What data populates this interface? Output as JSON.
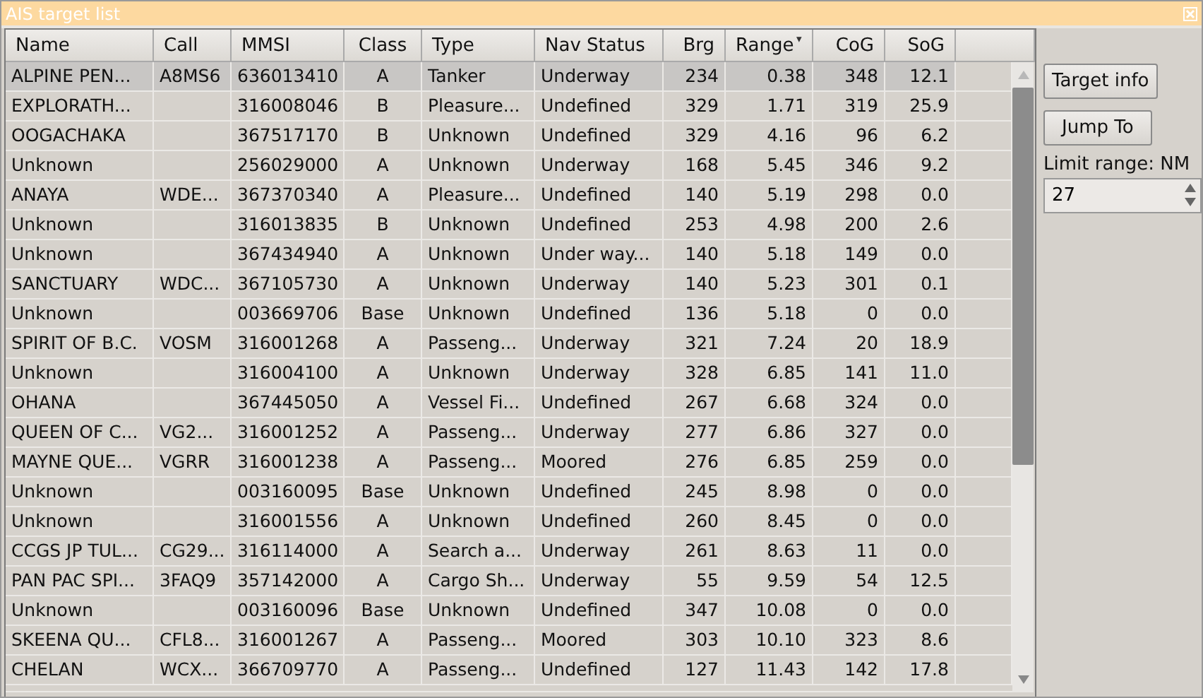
{
  "window": {
    "title": "AIS target list"
  },
  "table": {
    "columns": [
      {
        "label": "Name",
        "sorted": false
      },
      {
        "label": "Call",
        "sorted": false
      },
      {
        "label": "MMSI",
        "sorted": false
      },
      {
        "label": "Class",
        "sorted": false
      },
      {
        "label": "Type",
        "sorted": false
      },
      {
        "label": "Nav Status",
        "sorted": false
      },
      {
        "label": "Brg",
        "sorted": false
      },
      {
        "label": "Range",
        "sorted": true
      },
      {
        "label": "CoG",
        "sorted": false
      },
      {
        "label": "SoG",
        "sorted": false
      }
    ],
    "rows": [
      {
        "selected": true,
        "cells": [
          "ALPINE PEN...",
          "A8MS6",
          "636013410",
          "A",
          "Tanker",
          "Underway",
          "234",
          "0.38",
          "348",
          "12.1"
        ]
      },
      {
        "selected": false,
        "cells": [
          "EXPLORATH...",
          "",
          "316008046",
          "B",
          "Pleasure...",
          "Undefined",
          "329",
          "1.71",
          "319",
          "25.9"
        ]
      },
      {
        "selected": false,
        "cells": [
          "OOGACHAKA",
          "",
          "367517170",
          "B",
          "Unknown",
          "Undefined",
          "329",
          "4.16",
          "96",
          "6.2"
        ]
      },
      {
        "selected": false,
        "cells": [
          "Unknown",
          "",
          "256029000",
          "A",
          "Unknown",
          "Underway",
          "168",
          "5.45",
          "346",
          "9.2"
        ]
      },
      {
        "selected": false,
        "cells": [
          "ANAYA",
          "WDE...",
          "367370340",
          "A",
          "Pleasure...",
          "Undefined",
          "140",
          "5.19",
          "298",
          "0.0"
        ]
      },
      {
        "selected": false,
        "cells": [
          "Unknown",
          "",
          "316013835",
          "B",
          "Unknown",
          "Undefined",
          "253",
          "4.98",
          "200",
          "2.6"
        ]
      },
      {
        "selected": false,
        "cells": [
          "Unknown",
          "",
          "367434940",
          "A",
          "Unknown",
          "Under way...",
          "140",
          "5.18",
          "149",
          "0.0"
        ]
      },
      {
        "selected": false,
        "cells": [
          "SANCTUARY",
          "WDC...",
          "367105730",
          "A",
          "Unknown",
          "Underway",
          "140",
          "5.23",
          "301",
          "0.1"
        ]
      },
      {
        "selected": false,
        "cells": [
          "Unknown",
          "",
          "003669706",
          "Base",
          "Unknown",
          "Undefined",
          "136",
          "5.18",
          "0",
          "0.0"
        ]
      },
      {
        "selected": false,
        "cells": [
          "SPIRIT OF B.C.",
          "VOSM",
          "316001268",
          "A",
          "Passeng...",
          "Underway",
          "321",
          "7.24",
          "20",
          "18.9"
        ]
      },
      {
        "selected": false,
        "cells": [
          "Unknown",
          "",
          "316004100",
          "A",
          "Unknown",
          "Underway",
          "328",
          "6.85",
          "141",
          "11.0"
        ]
      },
      {
        "selected": false,
        "cells": [
          "OHANA",
          "",
          "367445050",
          "A",
          "Vessel Fi...",
          "Undefined",
          "267",
          "6.68",
          "324",
          "0.0"
        ]
      },
      {
        "selected": false,
        "cells": [
          "QUEEN OF C...",
          "VG2...",
          "316001252",
          "A",
          "Passeng...",
          "Underway",
          "277",
          "6.86",
          "327",
          "0.0"
        ]
      },
      {
        "selected": false,
        "cells": [
          "MAYNE QUE...",
          "VGRR",
          "316001238",
          "A",
          "Passeng...",
          "Moored",
          "276",
          "6.85",
          "259",
          "0.0"
        ]
      },
      {
        "selected": false,
        "cells": [
          "Unknown",
          "",
          "003160095",
          "Base",
          "Unknown",
          "Undefined",
          "245",
          "8.98",
          "0",
          "0.0"
        ]
      },
      {
        "selected": false,
        "cells": [
          "Unknown",
          "",
          "316001556",
          "A",
          "Unknown",
          "Undefined",
          "260",
          "8.45",
          "0",
          "0.0"
        ]
      },
      {
        "selected": false,
        "cells": [
          "CCGS JP TUL...",
          "CG29...",
          "316114000",
          "A",
          "Search a...",
          "Underway",
          "261",
          "8.63",
          "11",
          "0.0"
        ]
      },
      {
        "selected": false,
        "cells": [
          "PAN PAC SPI...",
          "3FAQ9",
          "357142000",
          "A",
          "Cargo Sh...",
          "Underway",
          "55",
          "9.59",
          "54",
          "12.5"
        ]
      },
      {
        "selected": false,
        "cells": [
          "Unknown",
          "",
          "003160096",
          "Base",
          "Unknown",
          "Undefined",
          "347",
          "10.08",
          "0",
          "0.0"
        ]
      },
      {
        "selected": false,
        "cells": [
          "SKEENA QU...",
          "CFL8...",
          "316001267",
          "A",
          "Passeng...",
          "Moored",
          "303",
          "10.10",
          "323",
          "8.6"
        ]
      },
      {
        "selected": false,
        "cells": [
          "CHELAN",
          "WCX...",
          "366709770",
          "A",
          "Passeng...",
          "Undefined",
          "127",
          "11.43",
          "142",
          "17.8"
        ]
      }
    ]
  },
  "buttons": [
    "Target info",
    "Jump To"
  ],
  "range_limit": {
    "label": "Limit range: NM",
    "value": "27"
  }
}
